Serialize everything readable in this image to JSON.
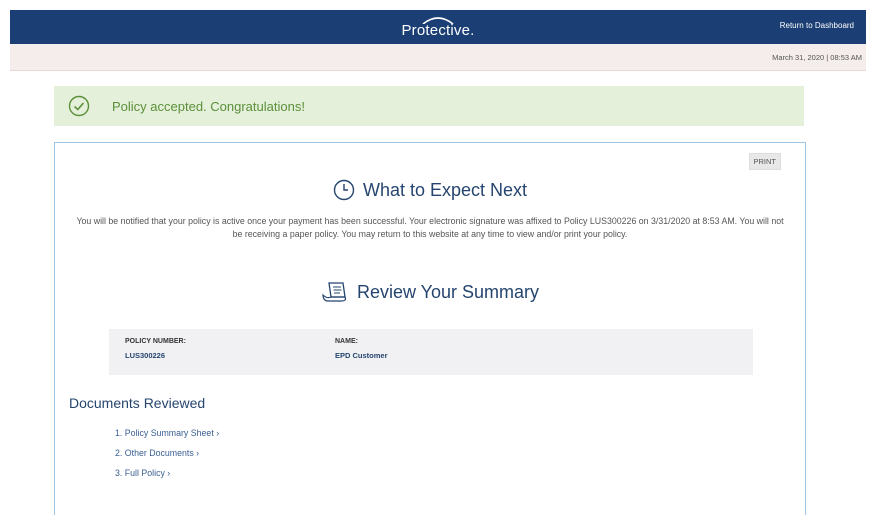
{
  "header": {
    "logo_text": "Protective.",
    "return_link": "Return to Dashboard"
  },
  "datebar": {
    "datetime": "March 31, 2020 | 08:53 AM"
  },
  "alert": {
    "message": "Policy accepted. Congratulations!",
    "icon": "check-circle-icon",
    "color": "#5b8f3a"
  },
  "card": {
    "print_label": "PRINT",
    "expect_heading": "What to Expect Next",
    "expect_text": "You will be notified that your policy is active once your payment has been successful. Your electronic signature was affixed to Policy LUS300226 on 3/31/2020 at 8:53 AM. You will not be receiving a paper policy. You may return to this website at any time to view and/or print your policy.",
    "review_heading": "Review Your Summary",
    "summary": {
      "policy_number_label": "POLICY NUMBER:",
      "policy_number": "LUS300226",
      "name_label": "NAME:",
      "name": "EPD Customer"
    },
    "docs_heading": "Documents Reviewed",
    "documents": [
      "1. Policy Summary Sheet ›",
      "2. Other Documents ›",
      "3. Full Policy ›"
    ]
  },
  "colors": {
    "header_bg": "#1b3f74",
    "heading": "#25456f",
    "alert_bg": "#e4f0d9"
  }
}
